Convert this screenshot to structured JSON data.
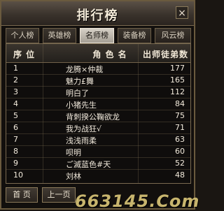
{
  "window": {
    "title": "排行榜",
    "close_glyph": "×"
  },
  "tabs": [
    {
      "label": "个人榜",
      "active": false
    },
    {
      "label": "英雄榜",
      "active": false
    },
    {
      "label": "名师榜",
      "active": true
    },
    {
      "label": "装备榜",
      "active": false
    },
    {
      "label": "风云榜",
      "active": false
    }
  ],
  "table": {
    "headers": {
      "rank": "序 位",
      "name": "角 色 名",
      "count": "出师徒弟数"
    },
    "rows": [
      {
        "rank": "1",
        "name": "龙腾×仲裁",
        "count": "177"
      },
      {
        "rank": "2",
        "name": "魅力£舞",
        "count": "165"
      },
      {
        "rank": "3",
        "name": "明白了",
        "count": "112"
      },
      {
        "rank": "4",
        "name": "小猪先生",
        "count": "84"
      },
      {
        "rank": "5",
        "name": "背刺揆公鞠欲龙",
        "count": "75"
      },
      {
        "rank": "6",
        "name": "我为战狂√",
        "count": "71"
      },
      {
        "rank": "7",
        "name": "浅浅雨柔",
        "count": "63"
      },
      {
        "rank": "8",
        "name": "呗明",
        "count": "60"
      },
      {
        "rank": "9",
        "name": "ご滅蓝色#天",
        "count": "52"
      },
      {
        "rank": "10",
        "name": "刘林",
        "count": "48"
      }
    ]
  },
  "pager": {
    "first": "首 页",
    "prev": "上一页"
  },
  "watermark": "663145.Com"
}
